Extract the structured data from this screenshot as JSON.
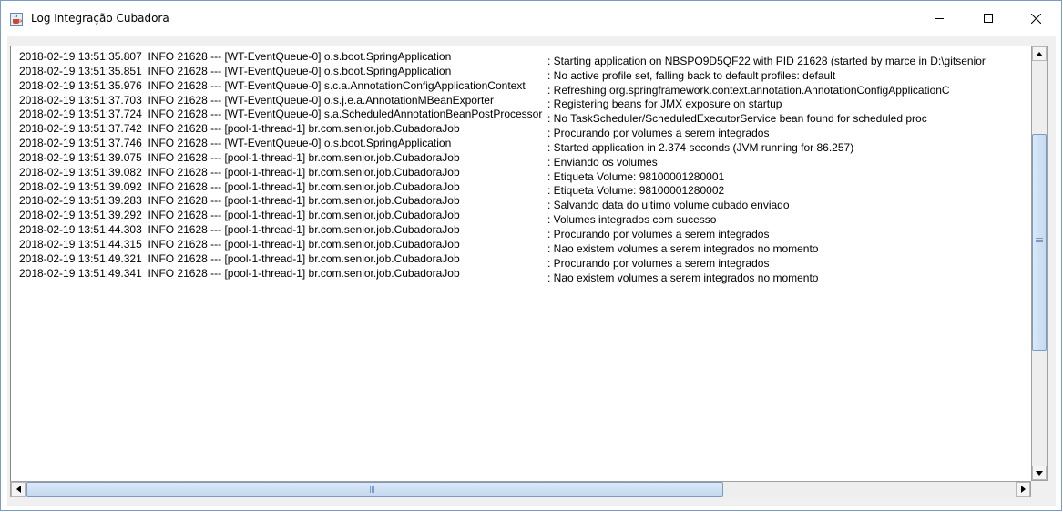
{
  "window": {
    "title": "Log Integração Cubadora",
    "minimize_icon": "minimize-icon",
    "maximize_icon": "maximize-icon",
    "close_icon": "close-icon",
    "app_icon": "java-cup-icon"
  },
  "log": {
    "lines": [
      {
        "prefix": "2018-02-19 13:51:35.807  INFO 21628 --- [WT-EventQueue-0] o.s.boot.SpringApplication",
        "message": ": Starting application on NBSPO9D5QF22 with PID 21628 (started by marce in D:\\gitsenior"
      },
      {
        "prefix": "2018-02-19 13:51:35.851  INFO 21628 --- [WT-EventQueue-0] o.s.boot.SpringApplication",
        "message": ": No active profile set, falling back to default profiles: default"
      },
      {
        "prefix": "2018-02-19 13:51:35.976  INFO 21628 --- [WT-EventQueue-0] s.c.a.AnnotationConfigApplicationContext",
        "message": ": Refreshing org.springframework.context.annotation.AnnotationConfigApplicationC"
      },
      {
        "prefix": "2018-02-19 13:51:37.703  INFO 21628 --- [WT-EventQueue-0] o.s.j.e.a.AnnotationMBeanExporter",
        "message": ": Registering beans for JMX exposure on startup"
      },
      {
        "prefix": "2018-02-19 13:51:37.724  INFO 21628 --- [WT-EventQueue-0] s.a.ScheduledAnnotationBeanPostProcessor",
        "message": ": No TaskScheduler/ScheduledExecutorService bean found for scheduled proc"
      },
      {
        "prefix": "2018-02-19 13:51:37.742  INFO 21628 --- [pool-1-thread-1] br.com.senior.job.CubadoraJob",
        "message": ": Procurando por volumes a serem integrados"
      },
      {
        "prefix": "2018-02-19 13:51:37.746  INFO 21628 --- [WT-EventQueue-0] o.s.boot.SpringApplication",
        "message": ": Started application in 2.374 seconds (JVM running for 86.257)"
      },
      {
        "prefix": "2018-02-19 13:51:39.075  INFO 21628 --- [pool-1-thread-1] br.com.senior.job.CubadoraJob",
        "message": ": Enviando os volumes"
      },
      {
        "prefix": "2018-02-19 13:51:39.082  INFO 21628 --- [pool-1-thread-1] br.com.senior.job.CubadoraJob",
        "message": ": Etiqueta Volume: 98100001280001"
      },
      {
        "prefix": "2018-02-19 13:51:39.092  INFO 21628 --- [pool-1-thread-1] br.com.senior.job.CubadoraJob",
        "message": ": Etiqueta Volume: 98100001280002"
      },
      {
        "prefix": "2018-02-19 13:51:39.283  INFO 21628 --- [pool-1-thread-1] br.com.senior.job.CubadoraJob",
        "message": ": Salvando data do ultimo volume cubado enviado"
      },
      {
        "prefix": "2018-02-19 13:51:39.292  INFO 21628 --- [pool-1-thread-1] br.com.senior.job.CubadoraJob",
        "message": ": Volumes integrados com sucesso"
      },
      {
        "prefix": "2018-02-19 13:51:44.303  INFO 21628 --- [pool-1-thread-1] br.com.senior.job.CubadoraJob",
        "message": ": Procurando por volumes a serem integrados"
      },
      {
        "prefix": "2018-02-19 13:51:44.315  INFO 21628 --- [pool-1-thread-1] br.com.senior.job.CubadoraJob",
        "message": ": Nao existem volumes a serem integrados no momento"
      },
      {
        "prefix": "2018-02-19 13:51:49.321  INFO 21628 --- [pool-1-thread-1] br.com.senior.job.CubadoraJob",
        "message": ": Procurando por volumes a serem integrados"
      },
      {
        "prefix": "2018-02-19 13:51:49.341  INFO 21628 --- [pool-1-thread-1] br.com.senior.job.CubadoraJob",
        "message": ": Nao existem volumes a serem integrados no momento"
      }
    ]
  },
  "scrollbars": {
    "up_arrow_icon": "scroll-up-arrow-icon",
    "down_arrow_icon": "scroll-down-arrow-icon",
    "left_arrow_icon": "scroll-left-arrow-icon",
    "right_arrow_icon": "scroll-right-arrow-icon"
  }
}
